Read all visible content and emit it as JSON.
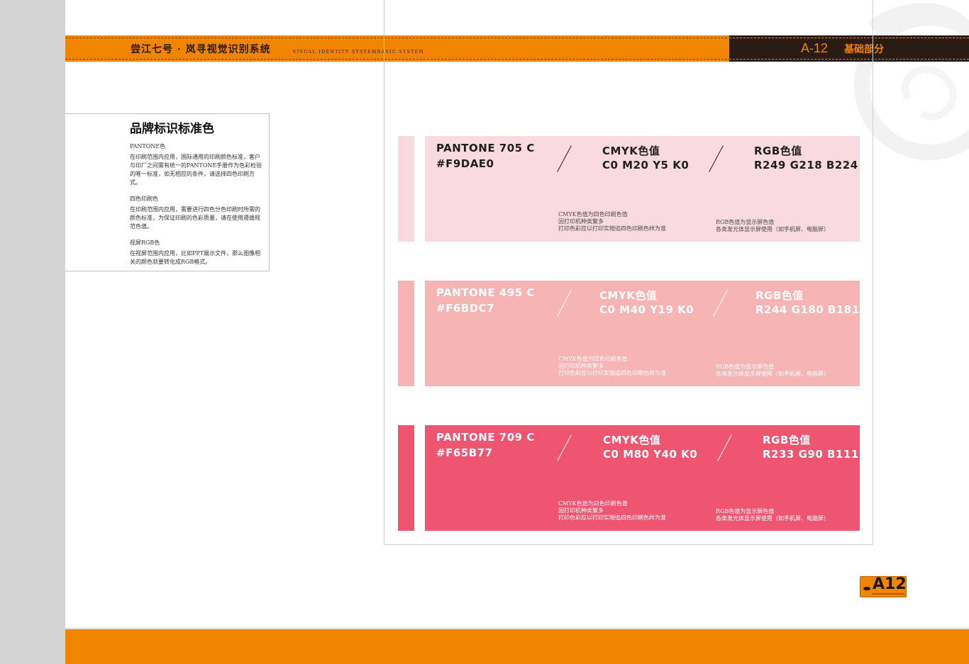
{
  "header": {
    "title": "尝江七号 · 岚寻视觉识别系统",
    "subtitle": "VISUAL IDENTITY SYSTEMBASIC SYSTEM",
    "page_code": "A-12",
    "section": "基础部分"
  },
  "intro": {
    "title": "品牌标识标准色",
    "sections": [
      {
        "title": "PANTONE色",
        "text": "在印刷范围内应用，国际通用的印刷颜色标准，客户与印厂之间需有统一的PANTONE手册作为色彩检验的唯一标准，如无相应的条件，请选择四色印刷方式。"
      },
      {
        "title": "四色印刷色",
        "text": "在印刷范围内应用，需要进行四色分色印刷时所需的颜色标准，为保证印刷的色彩质量，请在使用遵循规范色值。"
      },
      {
        "title": "视屏RGB色",
        "text": "在视屏范围内应用，比如PPT展示文件，那么图像相关的颜色就要转化成RGB格式。"
      }
    ]
  },
  "swatches": [
    {
      "pantone": "PANTONE 705 C",
      "hex": "#F9DAE0",
      "cmyk_label": "CMYK色值",
      "cmyk": "C0 M20 Y5 K0",
      "rgb_label": "RGB色值",
      "rgb": "R249 G218 B224",
      "cmyk_note": [
        "CMYK色值为四色印刷色值",
        "因打印机种类繁多",
        "打印色彩应以打印实物追四色印刷色样为准"
      ],
      "rgb_note": [
        "RGB色值为显示屏色值",
        "各类发光体显示屏使用（如手机屏、电脑屏）"
      ],
      "fill": "#f9dae0",
      "text_color": "#1f1f1f",
      "note_color": "#4a4a4a"
    },
    {
      "pantone": "PANTONE 495 C",
      "hex": "#F6BDC7",
      "cmyk_label": "CMYK色值",
      "cmyk": "C0 M40 Y19 K0",
      "rgb_label": "RGB色值",
      "rgb": "R244 G180 B181",
      "cmyk_note": [
        "CMYK色值为四色印刷色值",
        "因打印机种类繁多",
        "打印色彩应以打印实物追四色印刷色样为准"
      ],
      "rgb_note": [
        "RGB色值为显示屏色值",
        "各类发光体显示屏使用（如手机屏、电脑屏）"
      ],
      "fill": "#f6b4b5",
      "text_color": "#ffffff",
      "note_color": "#ffffff"
    },
    {
      "pantone": "PANTONE 709 C",
      "hex": "#F65B77",
      "cmyk_label": "CMYK色值",
      "cmyk": "C0 M80 Y40 K0",
      "rgb_label": "RGB色值",
      "rgb": "R233 G90 B111",
      "cmyk_note": [
        "CMYK色值为四色印刷色值",
        "因打印机种类繁多",
        "打印色彩应以打印实物追四色印刷色样为准"
      ],
      "rgb_note": [
        "RGB色值为显示屏色值",
        "各类发光体显示屏使用（如手机屏、电脑屏）"
      ],
      "fill": "#ef5471",
      "text_color": "#ffffff",
      "note_color": "#ffffff"
    }
  ],
  "badge": {
    "label": "A12"
  },
  "colors": {
    "brand_orange": "#f18500",
    "header_dark": "#2a1c14"
  }
}
